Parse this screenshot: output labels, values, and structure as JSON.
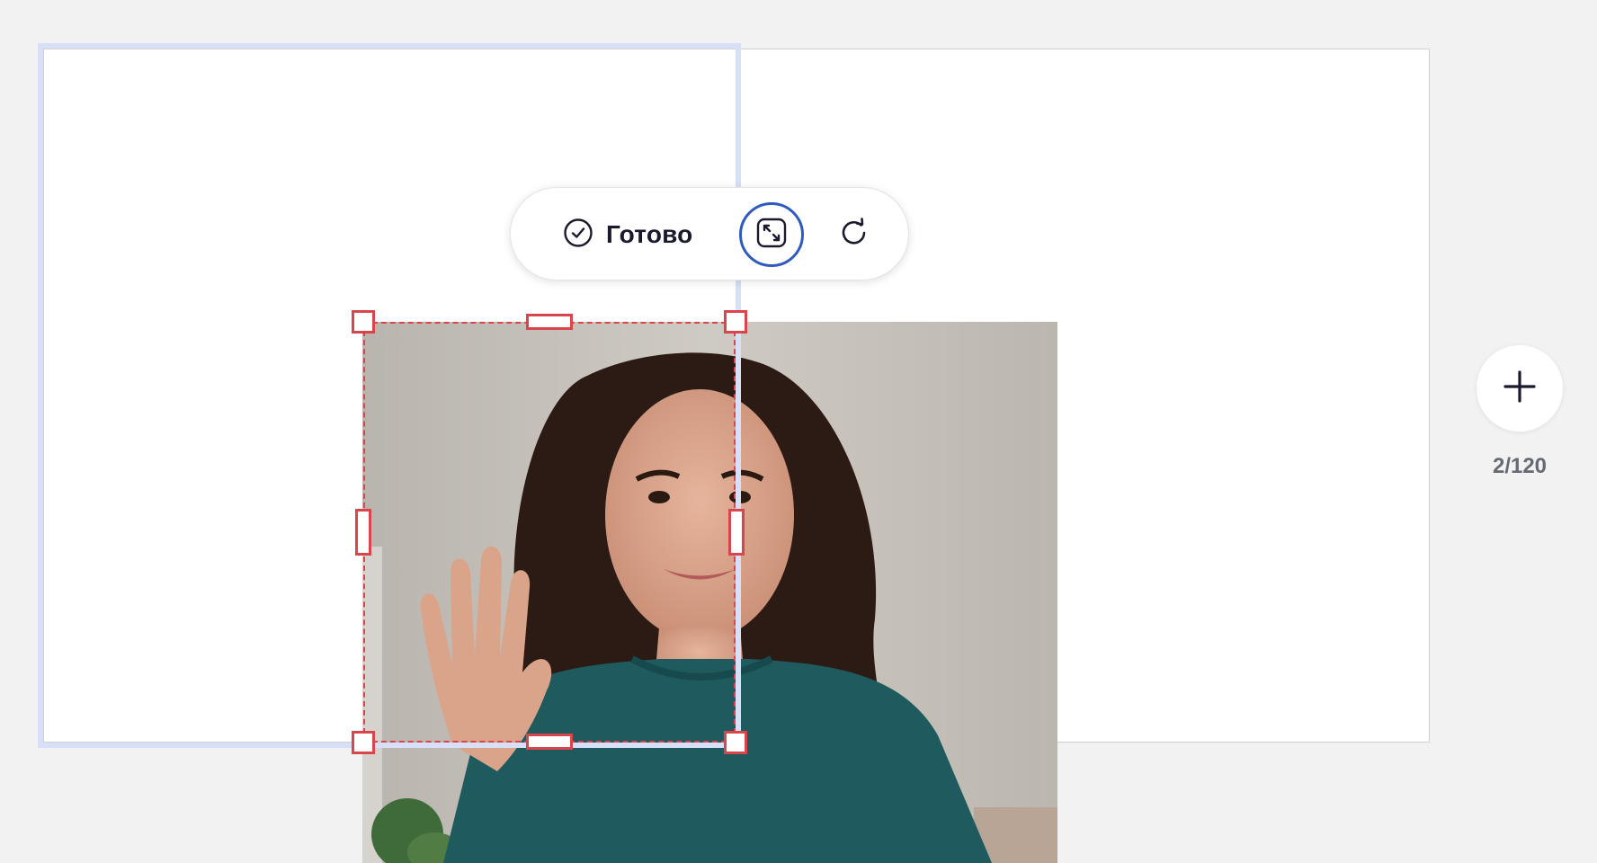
{
  "toolbar": {
    "done_label": "Готово",
    "done_icon": "check-circle-icon",
    "fit_icon": "fit-to-frame-icon",
    "rotate_icon": "rotate-clockwise-icon"
  },
  "sidebar": {
    "add_icon": "plus-icon",
    "counter": "2/120"
  },
  "colors": {
    "crop_handle": "#d9454a",
    "active_ring": "#2f5bbf",
    "cell_highlight": "#d8dff8",
    "canvas_bg": "#f2f2f2"
  }
}
